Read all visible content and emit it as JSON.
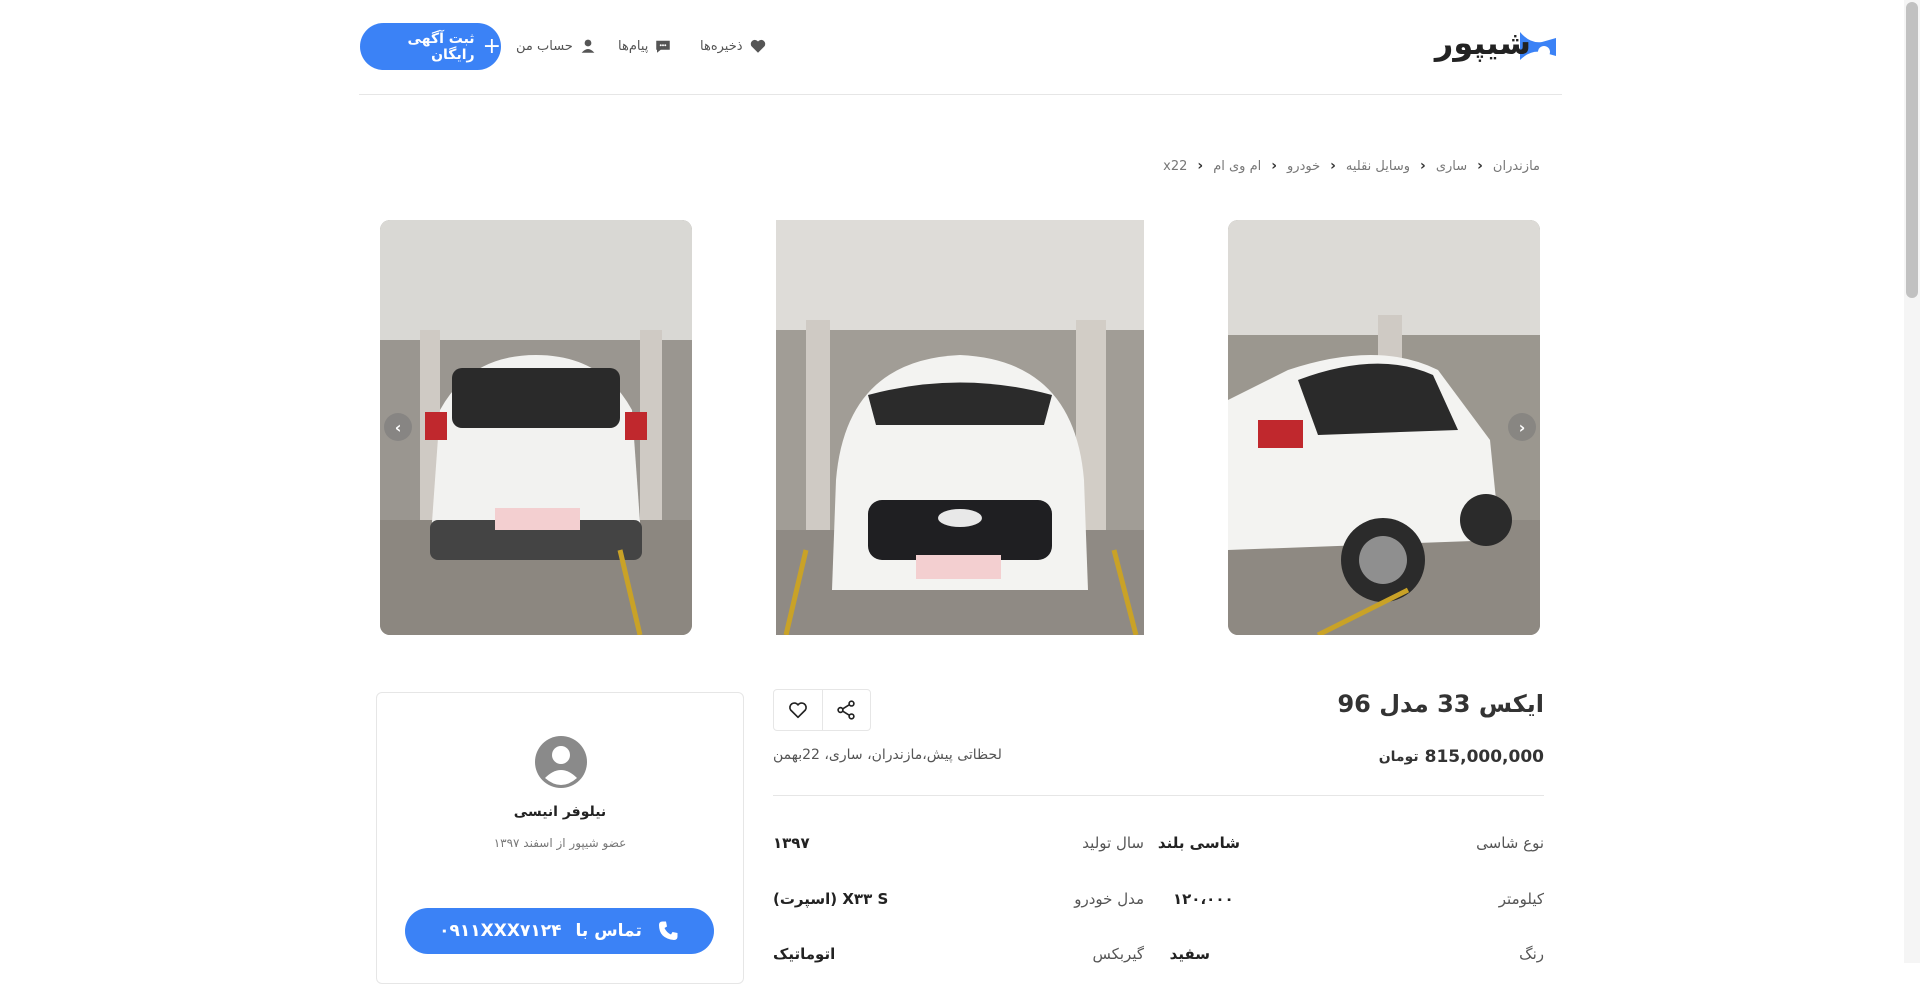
{
  "colors": {
    "accent": "#3b82f6",
    "border": "#e6e6e6"
  },
  "header": {
    "logo_text": "شیپور",
    "nav": {
      "saved": "ذخیره‌ها",
      "messages": "پیام‌ها",
      "account": "حساب من"
    },
    "post_button": "ثبت آگهی رایگان"
  },
  "breadcrumb": [
    "مازندران",
    "ساری",
    "وسایل نقلیه",
    "خودرو",
    "ام وی ام",
    "x22"
  ],
  "listing": {
    "title": "ایکس 33 مدل 96",
    "price": "815,000,000",
    "price_unit": "تومان",
    "location": "لحظاتی پیش،مازندران، ساری، 22بهمن",
    "specs": [
      {
        "label": "نوع شاسی",
        "value": "شاسی بلند"
      },
      {
        "label": "سال تولید",
        "value": "۱۳۹۷"
      },
      {
        "label": "کیلومتر",
        "value": "۱۲۰،۰۰۰"
      },
      {
        "label": "مدل خودرو",
        "value": "X۳۳ S (اسپرت)"
      },
      {
        "label": "رنگ",
        "value": "سفید"
      },
      {
        "label": "گیربکس",
        "value": "اتوماتیک"
      }
    ]
  },
  "seller": {
    "name": "نیلوفر انیسی",
    "member_since": "عضو شیپور از اسفند ۱۳۹۷",
    "call_label": "تماس با",
    "phone": "۰۹۱۱XXX۷۱۲۴"
  },
  "icons": {
    "saved": "heart-icon",
    "messages": "chat-icon",
    "account": "user-icon",
    "share": "share-icon",
    "favorite": "heart-outline-icon",
    "phone": "phone-icon"
  }
}
